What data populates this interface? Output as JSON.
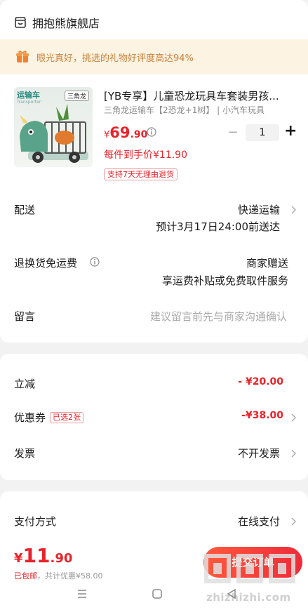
{
  "store": {
    "name": "拥抱熊旗舰店",
    "icon": "store-icon"
  },
  "banner": {
    "text": "眼光真好，挑选的礼物好评度高达94%",
    "icon": "gift-icon"
  },
  "product": {
    "thumb_title": "运输车",
    "thumb_subtitle": "Transporter",
    "thumb_tag": "三角龙",
    "title": "[YB专享】儿童恐龙玩具车套装男孩...",
    "spec": "三角龙运输车【2恐龙+1树】 | 小汽车玩具",
    "price_symbol": "¥",
    "price_int": "69",
    "price_dec": ".90",
    "quantity": "1",
    "minus_label": "−",
    "plus_label": "+",
    "per_piece": "每件到手价¥11.90",
    "return_badge": "支持7天无理由退货"
  },
  "delivery": {
    "label": "配送",
    "method": "快递运输",
    "eta": "预计3月17日24:00前送达"
  },
  "return_shipping": {
    "label": "退换货免运费",
    "value": "商家赠送",
    "detail": "享运费补贴或免费取件服务"
  },
  "message": {
    "label": "留言",
    "placeholder": "建议留言前先与商家沟通确认"
  },
  "discount": {
    "label": "立减",
    "value": "- ¥20.00"
  },
  "coupon": {
    "label": "优惠券",
    "tag": "已选2张",
    "value": "-¥38.00"
  },
  "invoice": {
    "label": "发票",
    "value": "不开发票"
  },
  "payment": {
    "label": "支付方式",
    "value": "在线支付"
  },
  "footer": {
    "total_symbol": "¥",
    "total_int": "11",
    "total_dec": ".90",
    "shipping": "已包邮",
    "savings": "，共计优惠¥58.00",
    "submit_label": "提交订单"
  },
  "watermark": {
    "url": "zhizhizhi.com"
  },
  "colors": {
    "accent": "#e8232b",
    "banner_bg": "#fdf3e2",
    "banner_text": "#c9813a",
    "page_bg": "#f2f2f2"
  }
}
